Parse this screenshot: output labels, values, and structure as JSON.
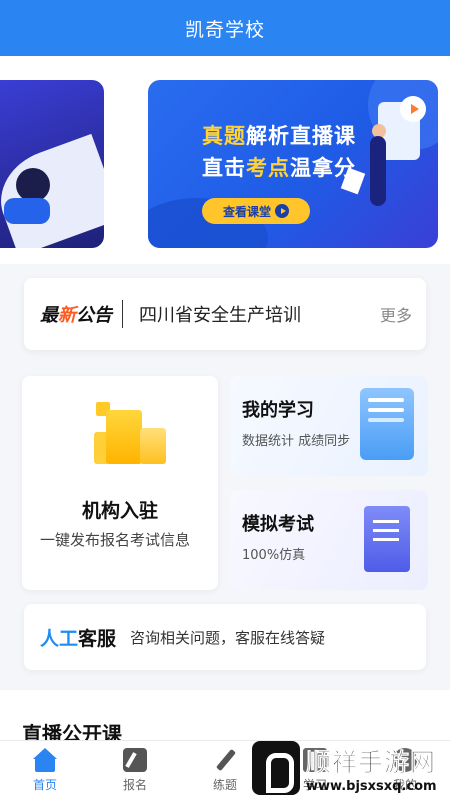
{
  "header": {
    "title": "凯奇学校"
  },
  "banner": {
    "title_line1_hl": "真题",
    "title_line1_rest": "解析直播课",
    "title_line2_a": "直击",
    "title_line2_hl": "考点",
    "title_line2_b": "温拿分",
    "button_label": "查看课堂"
  },
  "notice": {
    "tag_a": "最",
    "tag_hl": "新",
    "tag_b": "公告",
    "text": "四川省安全生产培训",
    "more": "更多"
  },
  "org_card": {
    "title": "机构入驻",
    "desc": "一键发布报名考试信息"
  },
  "study_card": {
    "title": "我的学习",
    "desc": "数据统计 成绩同步"
  },
  "exam_card": {
    "title": "模拟考试",
    "desc": "100%仿真"
  },
  "service": {
    "tag_hl": "人工",
    "tag_rest": "客服",
    "text": "咨询相关问题，客服在线答疑"
  },
  "live_section": {
    "title": "直播公开课"
  },
  "tabbar": {
    "items": [
      {
        "label": "首页",
        "icon": "home-icon",
        "active": true
      },
      {
        "label": "报名",
        "icon": "edit-icon"
      },
      {
        "label": "练题",
        "icon": "pencil-icon"
      },
      {
        "label": "学习",
        "icon": "book-icon"
      },
      {
        "label": "我的",
        "icon": "user-icon"
      }
    ]
  },
  "watermark": {
    "name": "顺祥手游网",
    "url": "www.bjsxsxq.com"
  },
  "colors": {
    "primary": "#2a85f3",
    "accent_yellow": "#ffd338",
    "accent_orange": "#ff5a1f"
  }
}
